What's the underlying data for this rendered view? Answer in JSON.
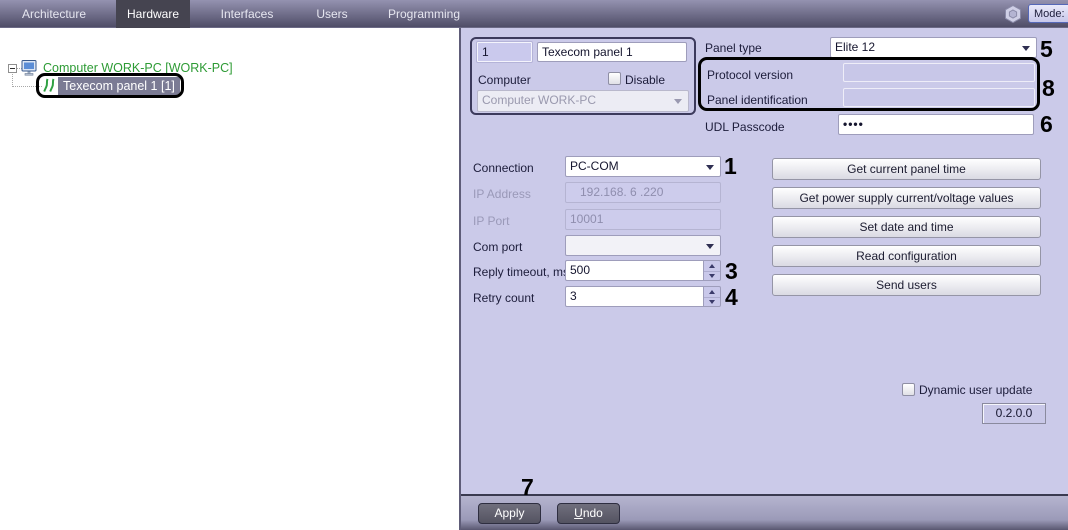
{
  "menu": {
    "tabs": [
      {
        "label": "Architecture",
        "active": false
      },
      {
        "label": "Hardware",
        "active": true
      },
      {
        "label": "Interfaces",
        "active": false
      },
      {
        "label": "Users",
        "active": false
      },
      {
        "label": "Programming",
        "active": false
      }
    ],
    "mode_label": "Mode:"
  },
  "tree": {
    "root_label": "Computer WORK-PC [WORK-PC]",
    "child_label": "Texecom panel 1 [1]"
  },
  "form": {
    "id_value": "1",
    "name_value": "Texecom panel 1",
    "computer_label": "Computer",
    "disable_label": "Disable",
    "computer_value": "Computer WORK-PC",
    "panel_type_label": "Panel type",
    "panel_type_value": "Elite 12",
    "protocol_version_label": "Protocol version",
    "protocol_version_value": "",
    "panel_identification_label": "Panel identification",
    "panel_identification_value": "",
    "udl_passcode_label": "UDL Passcode",
    "udl_passcode_value": "••••",
    "connection_label": "Connection",
    "connection_value": "PC-COM",
    "ip_address_label": "IP Address",
    "ip_address_value": "192.168. 6 .220",
    "ip_port_label": "IP Port",
    "ip_port_value": "10001",
    "com_port_label": "Com port",
    "com_port_value": "",
    "reply_timeout_label": "Reply timeout, ms",
    "reply_timeout_value": "500",
    "retry_count_label": "Retry count",
    "retry_count_value": "3",
    "action_buttons": [
      "Get current panel time",
      "Get power supply current/voltage values",
      "Set date and time",
      "Read configuration",
      "Send users"
    ],
    "dynamic_user_update_label": "Dynamic user update",
    "version_value": "0.2.0.0",
    "apply_label": "Apply",
    "undo_accel": "U",
    "undo_rest": "ndo"
  },
  "annotations": {
    "connection": "1",
    "reply_timeout": "3",
    "retry_count": "4",
    "panel_type": "5",
    "udl_passcode": "6",
    "apply": "7",
    "protocol_group": "8"
  },
  "icons": {
    "menubar_right": "hexagon-settings-icon",
    "tree_root": "computer-monitor-icon",
    "tree_child": "green-zigzag-panel-icon",
    "combo": "chevron-down-icon"
  },
  "colors": {
    "panel_background": "#cbcae9",
    "menubar_top": "#9492b0",
    "menubar_bottom": "#4f4d67",
    "active_tab": "#454450",
    "tree_root_text": "#2e9b35",
    "tree_selection": "#7b7b94",
    "annotation": "#000000"
  }
}
